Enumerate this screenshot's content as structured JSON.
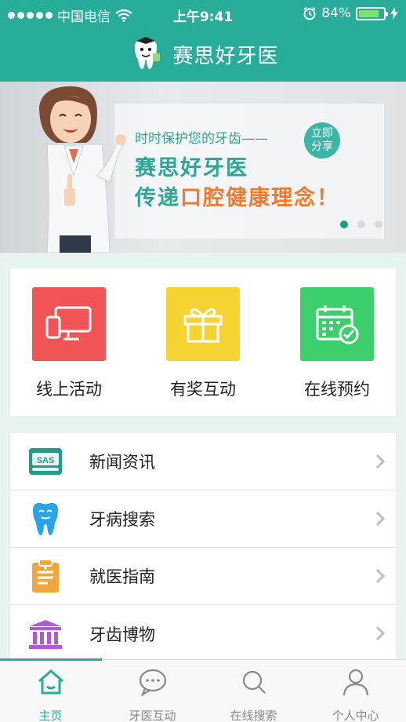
{
  "status_bar": {
    "carrier": "中国电信",
    "time": "上午9:41",
    "battery": "84%",
    "battery_level": 0.84
  },
  "header": {
    "title": "赛思好牙医",
    "logo_icon": "tooth-mascot-logo"
  },
  "banner": {
    "tagline": "时时保护您的牙齿——",
    "headline": "赛思好牙医",
    "subline_part1": "传递",
    "subline_part2": "口腔健康理念！",
    "share_line1": "立即",
    "share_line2": "分享",
    "page_count": 3,
    "active_page": 1
  },
  "quick_actions": [
    {
      "label": "线上活动",
      "icon": "monitor-icon",
      "color": "#f05454"
    },
    {
      "label": "有奖互动",
      "icon": "gift-icon",
      "color": "#f5d332"
    },
    {
      "label": "在线预约",
      "icon": "calendar-check-icon",
      "color": "#3ccf6c"
    }
  ],
  "menu": [
    {
      "label": "新闻资讯",
      "icon": "news-icon"
    },
    {
      "label": "牙病搜索",
      "icon": "tooth-icon"
    },
    {
      "label": "就医指南",
      "icon": "clipboard-icon"
    },
    {
      "label": "牙齿博物",
      "icon": "museum-icon"
    }
  ],
  "tabs": [
    {
      "label": "主页",
      "icon": "home-icon",
      "active": true
    },
    {
      "label": "牙医互动",
      "icon": "chat-icon",
      "active": false
    },
    {
      "label": "在线搜索",
      "icon": "search-icon",
      "active": false
    },
    {
      "label": "个人中心",
      "icon": "user-icon",
      "active": false
    }
  ],
  "colors": {
    "brand": "#27ad99",
    "accent_orange": "#f07a2b"
  }
}
